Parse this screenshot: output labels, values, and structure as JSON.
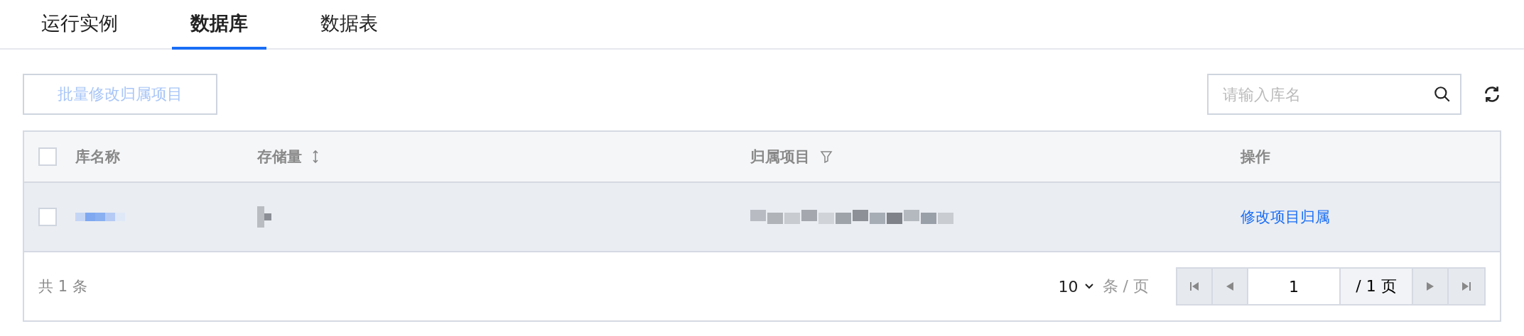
{
  "tabs": [
    {
      "label": "运行实例",
      "selected": false
    },
    {
      "label": "数据库",
      "selected": true
    },
    {
      "label": "数据表",
      "selected": false
    }
  ],
  "toolbar": {
    "batch_button": {
      "label": "批量修改归属项目",
      "disabled": true
    },
    "search": {
      "placeholder": "请输入库名"
    }
  },
  "table": {
    "select_all": {
      "checked": false
    },
    "columns": [
      {
        "label": "库名称",
        "kind": "checkbox"
      },
      {
        "label": "存储量",
        "kind": "sortable"
      },
      {
        "label": "归属项目",
        "kind": "filterable"
      },
      {
        "label": "操作",
        "kind": "plain"
      }
    ],
    "rows": [
      {
        "checked": false,
        "action": "修改项目归属"
      }
    ]
  },
  "footer": {
    "total": "共 1 条",
    "page_size": "10",
    "page_size_unit": "条 / 页",
    "page": "1",
    "page_count": "/ 1 页"
  }
}
